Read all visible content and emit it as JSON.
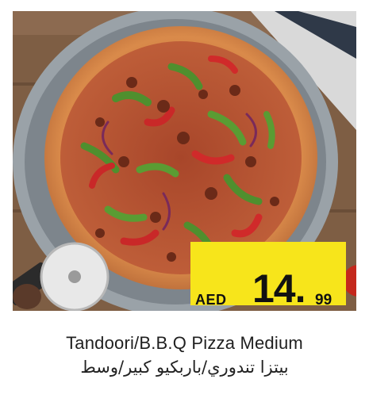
{
  "product": {
    "name_en": "Tandoori/B.B.Q Pizza Medium",
    "name_ar": "بيتزا تندوري/باربكيو كبير/وسط",
    "image_icon": "pizza-photo",
    "cutter_icon": "pizza-cutter-icon"
  },
  "price": {
    "currency": "AED",
    "integer": "14.",
    "decimal": "99",
    "tag_color": "#f7e51b"
  }
}
